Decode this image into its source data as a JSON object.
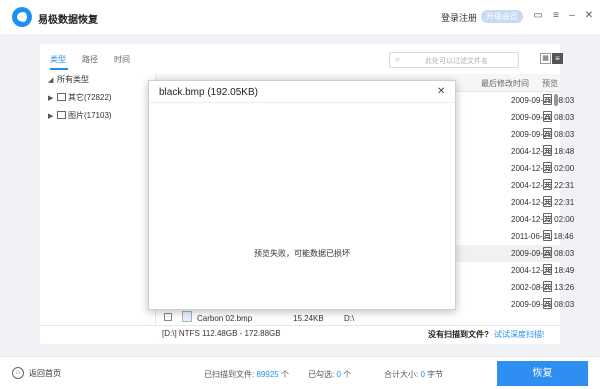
{
  "app": {
    "title": "易极数据恢复",
    "login": "登录注册",
    "upgrade": "升级会员"
  },
  "titlebar_icons": [
    "feedback-icon",
    "menu-icon",
    "minimize-icon",
    "close-icon"
  ],
  "tabs": [
    {
      "label": "类型"
    },
    {
      "label": "路径"
    },
    {
      "label": "时间"
    }
  ],
  "search": {
    "placeholder": "此处可以过滤文件名"
  },
  "tree": [
    {
      "label": "所有类型"
    },
    {
      "label": "其它(72822)"
    },
    {
      "label": "图片(17103)"
    }
  ],
  "columns": {
    "modified": "最后修改时间",
    "preview": "预览"
  },
  "rows": [
    {
      "date": "2009-09-29 08:03"
    },
    {
      "date": "2009-09-29 08:03"
    },
    {
      "date": "2009-09-29 08:03"
    },
    {
      "date": "2004-12-08 18:48"
    },
    {
      "date": "2004-12-02 02:00"
    },
    {
      "date": "2004-12-06 22:31"
    },
    {
      "date": "2004-12-06 22:31"
    },
    {
      "date": "2004-12-02 02:00"
    },
    {
      "date": "2011-06-21 18:46"
    },
    {
      "date": "2009-09-29 08:03"
    },
    {
      "date": "2004-12-08 18:49"
    },
    {
      "date": "2002-08-26 13:26"
    },
    {
      "date": "2009-09-29 08:03"
    }
  ],
  "last_row": {
    "name": "Carbon 02.bmp",
    "size": "15.24KB",
    "path": "D:\\"
  },
  "status": {
    "drive": "[D:\\] NTFS 112.48GB - 172.88GB",
    "no_result": "没有扫描到文件?",
    "deep_scan": "试试深度扫描!"
  },
  "bottom": {
    "home": "返回首页",
    "scanned_label": "已扫描到文件:",
    "scanned_count": "89925",
    "scanned_unit": "个",
    "checked_label": "已勾选:",
    "checked_count": "0",
    "checked_unit": "个",
    "total_label": "合计大小:",
    "total_count": "0",
    "total_unit": "字节",
    "recover": "恢复"
  },
  "dialog": {
    "title": "black.bmp  (192.05KB)",
    "message": "预览失败，可能数据已损坏"
  }
}
